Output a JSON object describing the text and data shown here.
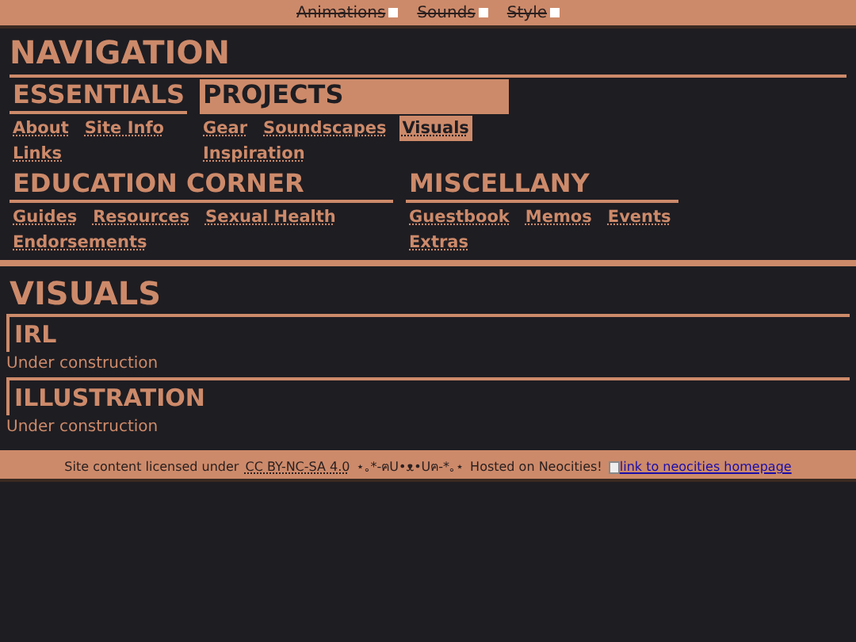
{
  "toggles": [
    {
      "label": "Animations",
      "checked": false
    },
    {
      "label": "Sounds",
      "checked": false
    },
    {
      "label": "Style",
      "checked": false
    }
  ],
  "navigation": {
    "title": "NAVIGATION",
    "rows": [
      [
        {
          "title": "ESSENTIALS",
          "selected": false,
          "links": [
            {
              "label": "About",
              "selected": false
            },
            {
              "label": "Site Info",
              "selected": false
            },
            {
              "label": "Links",
              "selected": false
            }
          ]
        },
        {
          "title": "PROJECTS",
          "selected": true,
          "links": [
            {
              "label": "Gear",
              "selected": false
            },
            {
              "label": "Soundscapes",
              "selected": false
            },
            {
              "label": "Visuals",
              "selected": true
            },
            {
              "label": "Inspiration",
              "selected": false
            }
          ]
        }
      ],
      [
        {
          "title": "EDUCATION CORNER",
          "selected": false,
          "links": [
            {
              "label": "Guides",
              "selected": false
            },
            {
              "label": "Resources",
              "selected": false
            },
            {
              "label": "Sexual Health",
              "selected": false
            },
            {
              "label": "Endorsements",
              "selected": false
            }
          ]
        },
        {
          "title": "MISCELLANY",
          "selected": false,
          "links": [
            {
              "label": "Guestbook",
              "selected": false
            },
            {
              "label": "Memos",
              "selected": false
            },
            {
              "label": "Events",
              "selected": false
            },
            {
              "label": "Extras",
              "selected": false
            }
          ]
        }
      ]
    ]
  },
  "page": {
    "title": "VISUALS",
    "sections": [
      {
        "title": "IRL",
        "text": "Under construction"
      },
      {
        "title": "ILLUSTRATION",
        "text": "Under construction"
      }
    ]
  },
  "footer": {
    "text": "Site content licensed under",
    "license": "CC BY-NC-SA 4.0",
    "decoration": "⋆｡*-ฅU•ᴥ•Uฅ-*｡⋆",
    "hosted": "Hosted on Neocities!",
    "link": "link to neocities homepage"
  }
}
